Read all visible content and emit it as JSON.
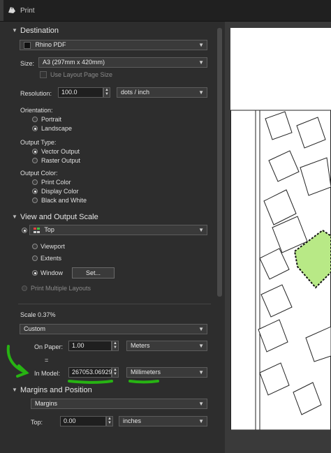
{
  "window": {
    "title": "Print"
  },
  "destination": {
    "header": "Destination",
    "printer": "Rhino PDF",
    "size_label": "Size:",
    "size_value": "A3 (297mm x 420mm)",
    "use_layout_page_size": "Use Layout Page Size",
    "resolution_label": "Resolution:",
    "resolution_value": "100.0",
    "resolution_unit": "dots / inch",
    "orientation_label": "Orientation:",
    "orientation_options": [
      "Portrait",
      "Landscape"
    ],
    "orientation_selected": "Landscape",
    "output_type_label": "Output Type:",
    "output_type_options": [
      "Vector Output",
      "Raster Output"
    ],
    "output_type_selected": "Vector Output",
    "output_color_label": "Output Color:",
    "output_color_options": [
      "Print Color",
      "Display Color",
      "Black and White"
    ],
    "output_color_selected": "Display Color"
  },
  "view_scale": {
    "header": "View and Output Scale",
    "view_value": "Top",
    "area_options": [
      "Viewport",
      "Extents",
      "Window"
    ],
    "area_selected": "Window",
    "set_button": "Set...",
    "print_multiple": "Print Multiple Layouts",
    "scale_label": "Scale 0.37%",
    "scale_preset": "Custom",
    "on_paper_label": "On Paper:",
    "on_paper_value": "1.00",
    "on_paper_unit": "Meters",
    "equals": "=",
    "in_model_label": "In Model:",
    "in_model_value": "267053.06929",
    "in_model_unit": "Millimeters"
  },
  "margins": {
    "header": "Margins and Position",
    "preset": "Margins",
    "top_label": "Top:",
    "top_value": "0.00",
    "top_unit": "inches"
  },
  "colors": {
    "annotation_green": "#27b313",
    "highlight_green": "#b8e986"
  },
  "icons": [
    "rhino-logo-icon",
    "printer-icon",
    "viewport-grid-icon",
    "chevron-down-icon"
  ]
}
